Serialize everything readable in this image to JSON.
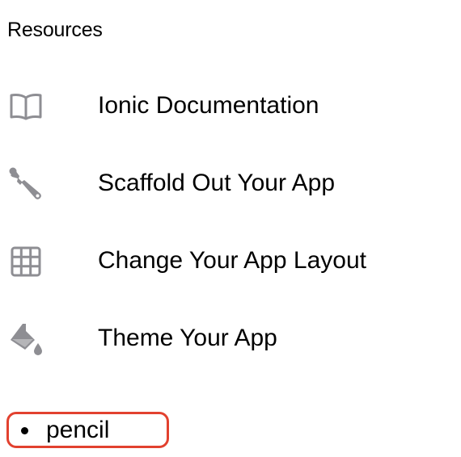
{
  "section": {
    "title": "Resources"
  },
  "items": [
    {
      "icon": "book-icon",
      "label": "Ionic Documentation"
    },
    {
      "icon": "wrench-icon",
      "label": "Scaffold Out Your App"
    },
    {
      "icon": "grid-icon",
      "label": "Change Your App Layout"
    },
    {
      "icon": "paint-bucket-icon",
      "label": "Theme Your App"
    }
  ],
  "annotation": {
    "text": "pencil",
    "color": "#e2412f"
  },
  "colors": {
    "icon": "#8e8e93",
    "text": "#000000",
    "background": "#ffffff"
  }
}
